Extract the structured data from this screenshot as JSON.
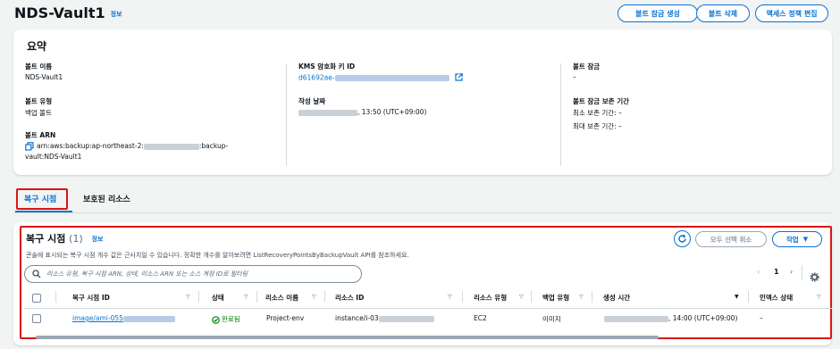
{
  "header": {
    "title": "NDS-Vault1",
    "info": "정보",
    "buttons": {
      "lock": "볼트 잠금 생성",
      "delete": "볼트 삭제",
      "policy": "액세스 정책 편집"
    }
  },
  "summary": {
    "title": "요약",
    "vault_name_label": "볼트 이름",
    "vault_name": "NDS-Vault1",
    "vault_type_label": "볼트 유형",
    "vault_type": "백업 볼트",
    "arn_label": "볼트 ARN",
    "arn_part1": "arn:aws:backup:ap-northeast-2:",
    "arn_part2": ":backup-",
    "arn_part3": "vault:NDS-Vault1",
    "kms_label": "KMS 암호화 키 ID",
    "kms_value": "d61692ae-",
    "created_label": "작성 날짜",
    "created_value": ", 13:50 (UTC+09:00)",
    "lock_label": "볼트 잠금",
    "lock_value": "–",
    "retention_label": "볼트 잠금 보존 기간",
    "min_retention": "최소 보존 기간: –",
    "max_retention": "최대 보존 기간: –"
  },
  "tabs": {
    "recovery_points": "복구 시점",
    "protected_resources": "보호된 리소스"
  },
  "recovery": {
    "title": "복구 시점",
    "count": "(1)",
    "info": "정보",
    "description": "콘솔에 표시되는 복구 시점 개수 값은 근사치일 수 있습니다. 정확한 개수를 알아보려면 ListRecoveryPointsByBackupVault API를 참조하세요.",
    "deselect_all": "모두 선택 취소",
    "actions": "작업",
    "search_placeholder": "리소스 유형, 복구 시점 ARN, 상태, 리소스 ARN 또는 소스 계정 ID로 필터링",
    "page": "1",
    "columns": {
      "id": "복구 시점 ID",
      "status": "상태",
      "resource_name": "리소스 이름",
      "resource_id": "리소스 ID",
      "resource_type": "리소스 유형",
      "backup_type": "백업 유형",
      "created": "생성 시간",
      "index_status": "인덱스 상태"
    },
    "row": {
      "id": "image/ami-055",
      "status": "완료됨",
      "resource_name": "Project-env",
      "resource_id": "instance/i-03",
      "resource_type": "EC2",
      "backup_type": "이미지",
      "created": ", 14:00 (UTC+09:00)",
      "index_status": "–"
    }
  },
  "colors": {
    "link": "#0972d3",
    "success": "#037f0c",
    "highlight": "#d91515"
  }
}
